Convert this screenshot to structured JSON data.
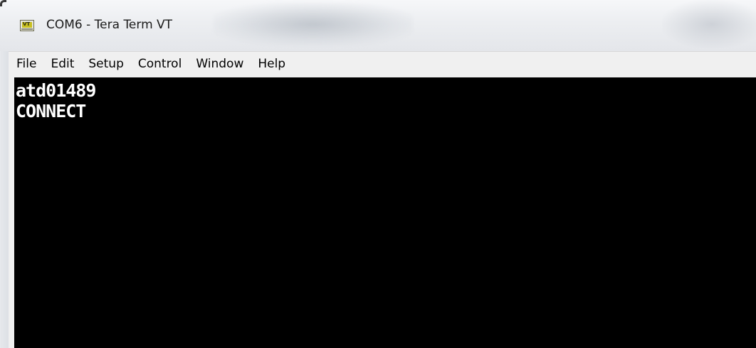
{
  "window": {
    "title": "COM6 - Tera Term VT",
    "icon": "tera-term-vt-icon",
    "icon_label": "VT"
  },
  "menu": {
    "items": [
      {
        "label": "File"
      },
      {
        "label": "Edit"
      },
      {
        "label": "Setup"
      },
      {
        "label": "Control"
      },
      {
        "label": "Window"
      },
      {
        "label": "Help"
      }
    ]
  },
  "terminal": {
    "background": "#000000",
    "foreground": "#ffffff",
    "lines": [
      "atd01489",
      "CONNECT"
    ]
  }
}
